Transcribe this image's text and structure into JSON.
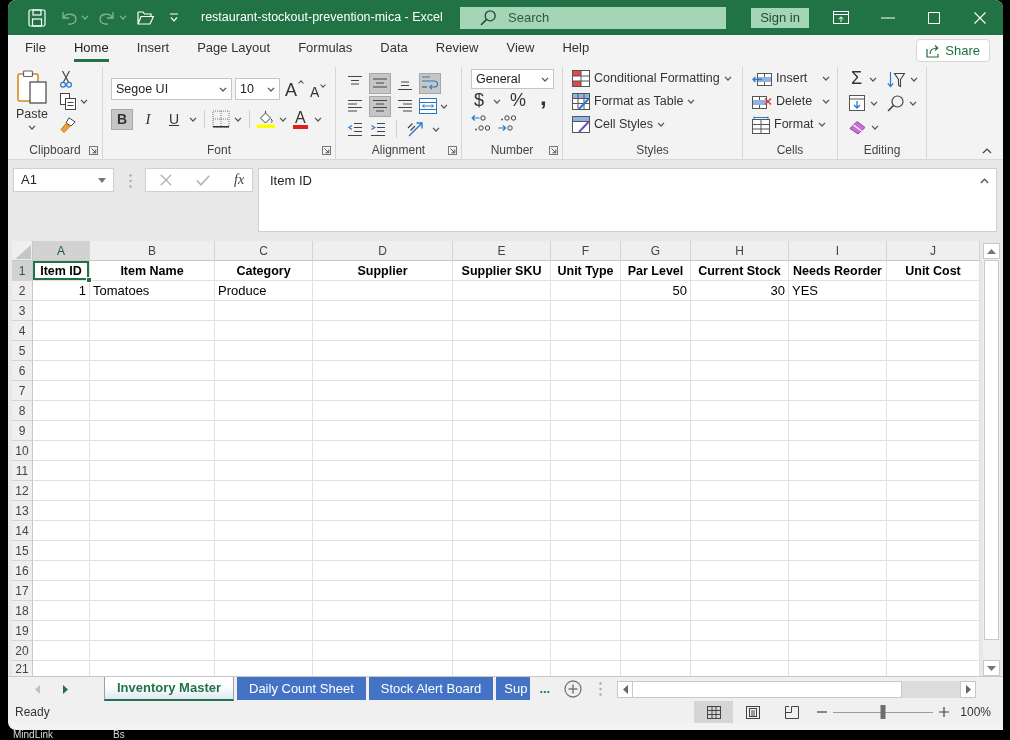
{
  "title_bar": {
    "quick_access": [
      {
        "kind": "save",
        "disabled": false
      },
      {
        "kind": "undo",
        "disabled": true
      },
      {
        "kind": "redo",
        "disabled": true
      },
      {
        "kind": "open",
        "disabled": false
      },
      {
        "kind": "customize",
        "disabled": false
      }
    ],
    "title": "restaurant-stockout-prevention-mica - Excel",
    "search": {
      "placeholder": "Search"
    },
    "sign_in": "Sign in"
  },
  "ribbon_tabs": [
    {
      "label": "File",
      "selected": false
    },
    {
      "label": "Home",
      "selected": true
    },
    {
      "label": "Insert",
      "selected": false
    },
    {
      "label": "Page Layout",
      "selected": false
    },
    {
      "label": "Formulas",
      "selected": false
    },
    {
      "label": "Data",
      "selected": false
    },
    {
      "label": "Review",
      "selected": false
    },
    {
      "label": "View",
      "selected": false
    },
    {
      "label": "Help",
      "selected": false
    }
  ],
  "share_button": "Share",
  "ribbon": {
    "clipboard": {
      "paste": "Paste",
      "label": "Clipboard"
    },
    "font": {
      "font_name": "Segoe UI",
      "font_size": "10",
      "grow": "A",
      "shrink": "A",
      "format_buttons": [
        {
          "kind": "bold",
          "label": "B",
          "selected": true
        },
        {
          "kind": "italic",
          "label": "I",
          "selected": false
        },
        {
          "kind": "underline",
          "label": "U",
          "selected": false
        }
      ],
      "font_color": "A",
      "label": "Font"
    },
    "alignment": {
      "vertical": [
        {
          "kind": "top",
          "selected": false
        },
        {
          "kind": "middle",
          "selected": true
        },
        {
          "kind": "bottom",
          "selected": false
        }
      ],
      "wrap_text": true,
      "horizontal": [
        {
          "kind": "left",
          "selected": false
        },
        {
          "kind": "center",
          "selected": true
        },
        {
          "kind": "right",
          "selected": false
        }
      ],
      "label": "Alignment"
    },
    "number": {
      "format": "General",
      "currency": "$",
      "percent": "%",
      "comma": ",",
      "label": "Number"
    },
    "styles": {
      "commands": [
        "Conditional Formatting",
        "Format as Table",
        "Cell Styles"
      ],
      "label": "Styles"
    },
    "cells": {
      "commands": [
        "Insert",
        "Delete",
        "Format"
      ],
      "label": "Cells"
    },
    "editing": {
      "sum": "Σ",
      "label": "Editing"
    }
  },
  "formula_bar": {
    "name_box": "A1",
    "function_label": "fx",
    "content": "Item ID"
  },
  "sheet": {
    "columns": [
      {
        "letter": "A",
        "selected": true
      },
      {
        "letter": "B",
        "selected": false
      },
      {
        "letter": "C",
        "selected": false
      },
      {
        "letter": "D",
        "selected": false
      },
      {
        "letter": "E",
        "selected": false
      },
      {
        "letter": "F",
        "selected": false
      },
      {
        "letter": "G",
        "selected": false
      },
      {
        "letter": "H",
        "selected": false
      },
      {
        "letter": "I",
        "selected": false
      },
      {
        "letter": "J",
        "selected": false
      }
    ],
    "rows": [
      {
        "number": "1",
        "selected": true,
        "cells": [
          {
            "kind": "header",
            "value": "Item ID"
          },
          {
            "kind": "header",
            "value": "Item Name"
          },
          {
            "kind": "header",
            "value": "Category"
          },
          {
            "kind": "header",
            "value": "Supplier"
          },
          {
            "kind": "header",
            "value": "Supplier SKU"
          },
          {
            "kind": "header",
            "value": "Unit Type"
          },
          {
            "kind": "header",
            "value": "Par Level"
          },
          {
            "kind": "header",
            "value": "Current Stock"
          },
          {
            "kind": "header",
            "value": "Needs Reorder"
          },
          {
            "kind": "header",
            "value": "Unit Cost"
          }
        ]
      },
      {
        "number": "2",
        "selected": false,
        "cells": [
          {
            "kind": "number",
            "value": "1"
          },
          {
            "kind": "text",
            "value": "Tomatoes"
          },
          {
            "kind": "text",
            "value": "Produce"
          },
          null,
          null,
          null,
          {
            "kind": "number",
            "value": "50"
          },
          {
            "kind": "number",
            "value": "30"
          },
          {
            "kind": "text",
            "value": "YES"
          },
          null
        ]
      },
      {
        "number": "3",
        "selected": false
      },
      {
        "number": "4",
        "selected": false
      },
      {
        "number": "5",
        "selected": false
      },
      {
        "number": "6",
        "selected": false
      },
      {
        "number": "7",
        "selected": false
      },
      {
        "number": "8",
        "selected": false
      },
      {
        "number": "9",
        "selected": false
      },
      {
        "number": "10",
        "selected": false
      },
      {
        "number": "11",
        "selected": false
      },
      {
        "number": "12",
        "selected": false
      },
      {
        "number": "13",
        "selected": false
      },
      {
        "number": "14",
        "selected": false
      },
      {
        "number": "15",
        "selected": false
      },
      {
        "number": "16",
        "selected": false
      },
      {
        "number": "17",
        "selected": false
      },
      {
        "number": "18",
        "selected": false
      },
      {
        "number": "19",
        "selected": false
      },
      {
        "number": "20",
        "selected": false
      },
      {
        "number": "21",
        "selected": false
      }
    ]
  },
  "sheet_tabs": [
    {
      "label": "Inventory Master",
      "selected": true
    },
    {
      "label": "Daily Count Sheet",
      "selected": false
    },
    {
      "label": "Stock Alert Board",
      "selected": false
    },
    {
      "label": "Sup",
      "selected": false
    }
  ],
  "more_tabs": "...",
  "status_bar": {
    "status": "Ready",
    "views": [
      {
        "kind": "normal",
        "selected": true
      },
      {
        "kind": "page_layout",
        "selected": false
      },
      {
        "kind": "page_break",
        "selected": false
      }
    ],
    "zoom": {
      "level": 0.5,
      "reading": "100%"
    }
  },
  "desktop_labels": [
    "MindLink",
    "Bs"
  ]
}
